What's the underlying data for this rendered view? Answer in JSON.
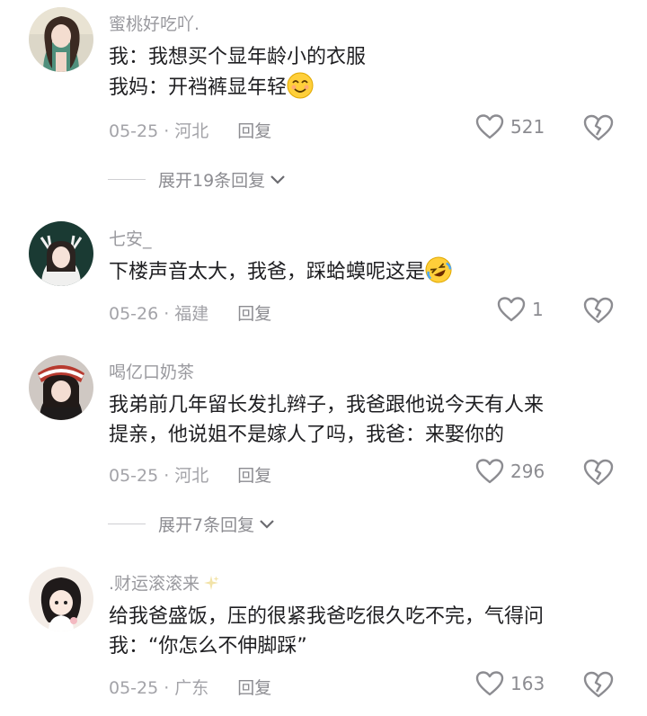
{
  "comments": [
    {
      "username": "蜜桃好吃吖.",
      "line1": "我：我想买个显年龄小的衣服",
      "line2": "我妈：开裆裤显年轻",
      "date": "05-25",
      "location": "河北",
      "reply_label": "回复",
      "likes": "521",
      "expand_label": "展开19条回复"
    },
    {
      "username": "七安_",
      "line1": "下楼声音太大，我爸，踩蛤蟆呢这是",
      "date": "05-26",
      "location": "福建",
      "reply_label": "回复",
      "likes": "1"
    },
    {
      "username": "喝亿口奶茶",
      "line1": "我弟前几年留长发扎辫子，我爸跟他说今天有人来",
      "line2": "提亲，他说姐不是嫁人了吗，我爸：来娶你的",
      "date": "05-25",
      "location": "河北",
      "reply_label": "回复",
      "likes": "296",
      "expand_label": "展开7条回复"
    },
    {
      "username": ".财运滚滚来",
      "line1": "给我爸盛饭，压的很紧我爸吃很久吃不完，气得问",
      "line2": "我：“你怎么不伸脚踩”",
      "date": "05-25",
      "location": "广东",
      "reply_label": "回复",
      "likes": "163"
    }
  ],
  "icons": {
    "like": "heart-outline-icon",
    "dislike": "broken-heart-icon",
    "expand": "chevron-down-icon",
    "emoji1": "smiling-emoji-icon",
    "emoji2": "rolling-on-floor-laughing-emoji-icon"
  },
  "colors": {
    "username": "#9a9a9f",
    "text": "#1f1f22",
    "meta": "#a3a3a8"
  }
}
